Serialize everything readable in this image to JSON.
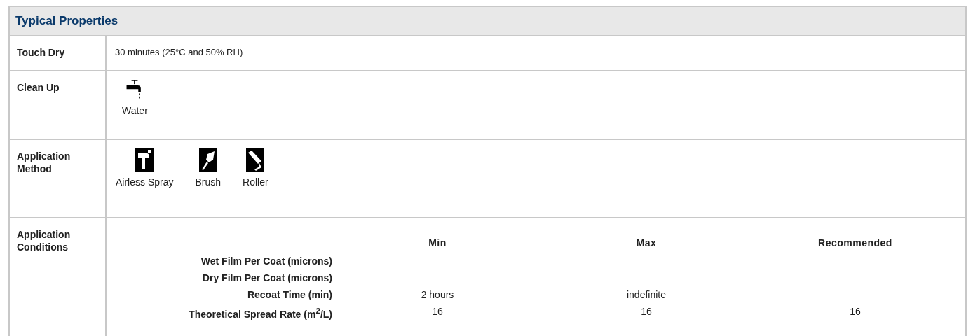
{
  "title": "Typical Properties",
  "touch_dry": {
    "label": "Touch Dry",
    "value": "30 minutes (25°C and 50% RH)"
  },
  "clean_up": {
    "label": "Clean Up",
    "items": [
      {
        "kind": "faucet",
        "label": "Water"
      }
    ]
  },
  "application_method": {
    "label": "Application Method",
    "items": [
      {
        "kind": "spray",
        "label": "Airless Spray"
      },
      {
        "kind": "brush",
        "label": "Brush"
      },
      {
        "kind": "roller",
        "label": "Roller"
      }
    ]
  },
  "application_conditions": {
    "label": "Application Conditions",
    "columns": [
      "Min",
      "Max",
      "Recommended"
    ],
    "rows": [
      {
        "label": "Wet Film Per Coat (microns)"
      },
      {
        "label": "Dry Film Per Coat (microns)"
      },
      {
        "label": "Recoat Time (min)",
        "min": "2 hours",
        "max": "indefinite"
      },
      {
        "label": "Theoretical Spread Rate (m$^{2}$/L)",
        "min": "16",
        "max": "16",
        "recommended": "16"
      }
    ]
  }
}
